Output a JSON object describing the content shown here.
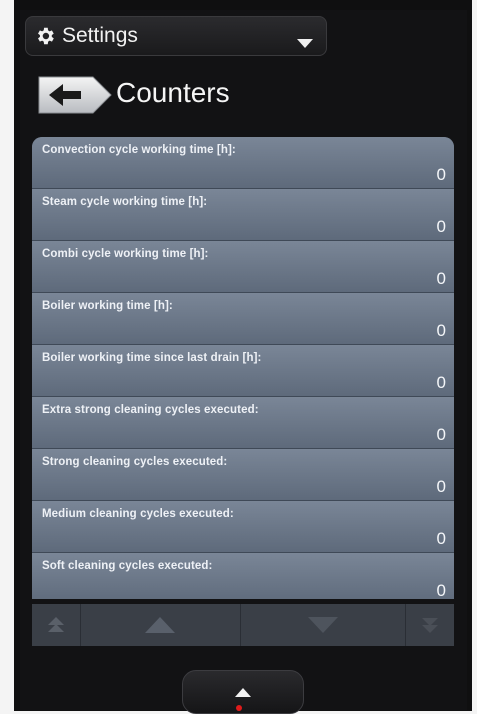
{
  "header": {
    "title": "Settings"
  },
  "page": {
    "title": "Counters"
  },
  "counters": [
    {
      "label": "Convection cycle working time [h]:",
      "value": "0"
    },
    {
      "label": "Steam cycle working time [h]:",
      "value": "0"
    },
    {
      "label": "Combi cycle working time [h]:",
      "value": "0"
    },
    {
      "label": "Boiler working time [h]:",
      "value": "0"
    },
    {
      "label": "Boiler working time since last drain [h]:",
      "value": "0"
    },
    {
      "label": "Extra strong cleaning cycles executed:",
      "value": "0"
    },
    {
      "label": "Strong cleaning cycles executed:",
      "value": "0"
    },
    {
      "label": "Medium cleaning cycles executed:",
      "value": "0"
    },
    {
      "label": "Soft cleaning cycles executed:",
      "value": "0"
    }
  ],
  "colors": {
    "panel": "#6f7b8c",
    "screen": "#121214",
    "text": "#f0f0f0"
  },
  "icons": [
    "gear-icon",
    "chevron-down-icon",
    "arrow-left-icon",
    "scroll-top-icon",
    "scroll-up-icon",
    "scroll-down-icon",
    "scroll-bottom-icon",
    "chevron-up-icon"
  ]
}
